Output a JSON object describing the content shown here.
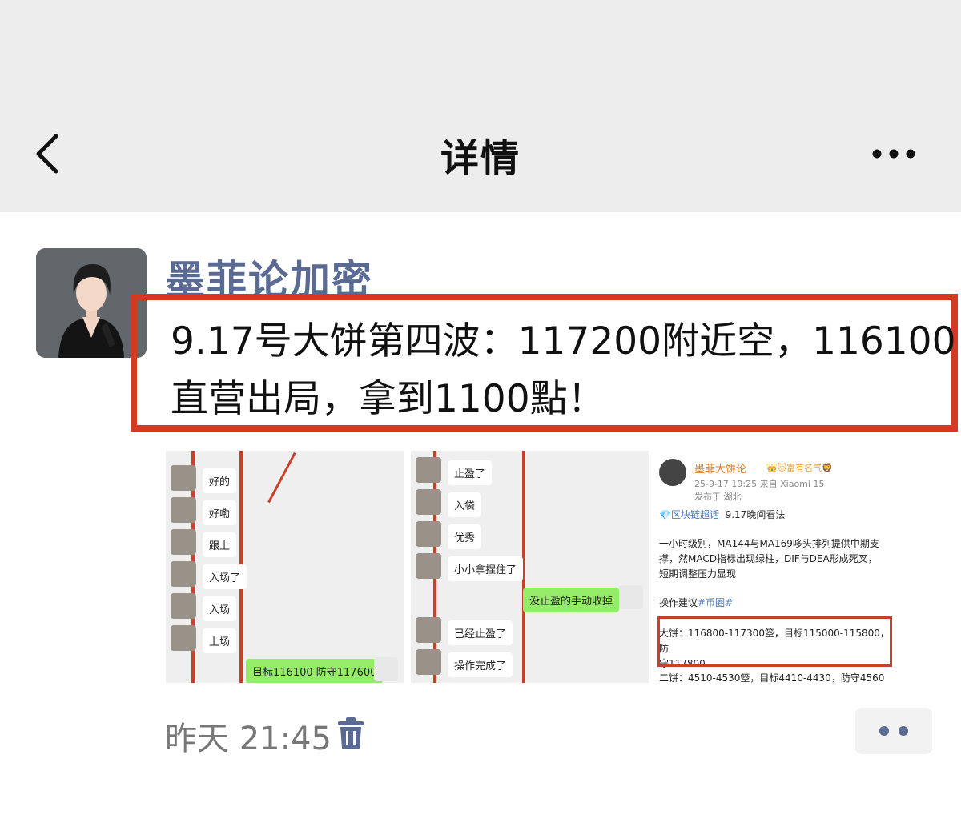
{
  "header": {
    "title": "详情"
  },
  "post": {
    "author": "墨菲论加密",
    "text_line1": "9.17号大饼第四波：117200附近空，116100",
    "text_line2": "直营出局，拿到1100點！",
    "timestamp": "昨天 21:45"
  },
  "images": {
    "chat1": {
      "messages": [
        "好的",
        "好嘞",
        "跟上",
        "入场了",
        "入场",
        "上场"
      ],
      "outgoing": "目标116100  防守117600"
    },
    "chat2": {
      "messages": [
        "止盈了",
        "入袋",
        "优秀",
        "小小拿捏住了",
        "已经止盈了",
        "操作完成了"
      ],
      "outgoing": "没止盈的手动收掉"
    },
    "weibo": {
      "name": "墨菲大饼论",
      "badges": "👑🐱富有名气🦁",
      "meta": "25-9-17 19:25  来自 Xiaomi 15",
      "location": "发布于 湖北",
      "tag_link": "💎区块链超话",
      "tag_text": "9.17晚间看法",
      "para1_l1": "一小时级别，MA144与MA169哆头排列提供中期支",
      "para1_l2": "撑，然MACD指标出现绿柱，DIF与DEA形成死叉，",
      "para1_l3": "短期调整压力显现",
      "advice_label": "操作建议",
      "advice_tag": "#币圈#",
      "btc_l1": "大饼：116800-117300箜，目标115000-115800，防",
      "btc_l2": "守117800",
      "eth_line": "二饼：4510-4530箜，目标4410-4430，防守4560"
    }
  },
  "colors": {
    "author": "#5a6a93",
    "highlight_border": "#d23a22",
    "topbar_bg": "#ededed"
  }
}
